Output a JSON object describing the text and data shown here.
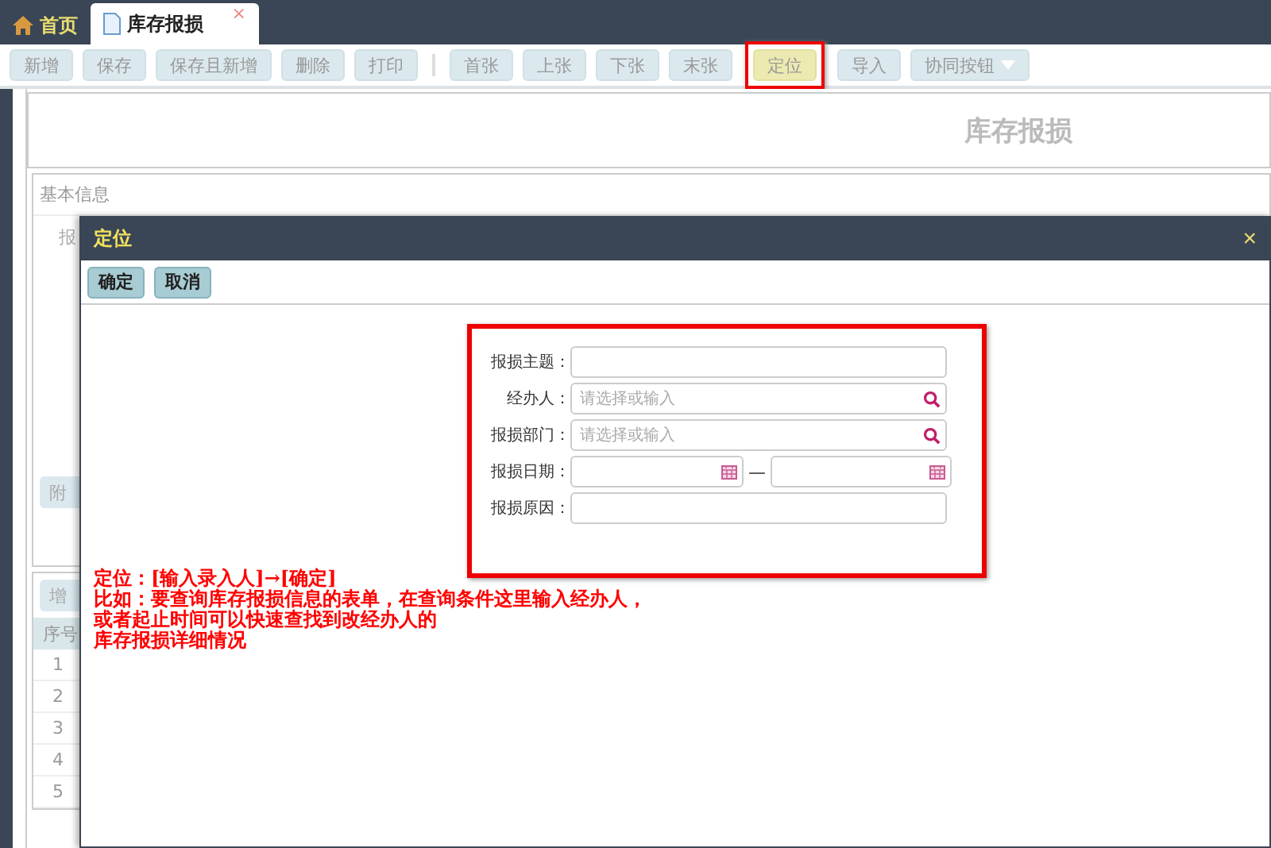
{
  "tabs": [
    {
      "label": "首页",
      "kind": "home",
      "selected": false
    },
    {
      "label": "库存报损",
      "kind": "doc",
      "selected": true,
      "close": "×"
    }
  ],
  "toolbar": [
    {
      "label": "新增",
      "highlighted": false
    },
    {
      "label": "保存",
      "highlighted": false
    },
    {
      "label": "保存且新增",
      "highlighted": false
    },
    {
      "label": "删除",
      "highlighted": false
    },
    {
      "label": "打印",
      "highlighted": false,
      "separator_after": true
    },
    {
      "label": "首张",
      "highlighted": false
    },
    {
      "label": "上张",
      "highlighted": false
    },
    {
      "label": "下张",
      "highlighted": false
    },
    {
      "label": "末张",
      "highlighted": false
    },
    {
      "label": "定位",
      "highlighted": true
    },
    {
      "label": "导入",
      "highlighted": false
    },
    {
      "label": "协同按钮",
      "highlighted": false,
      "dropdown": true
    }
  ],
  "page": {
    "title": "库存报损",
    "section": "基本信息",
    "field_label": "报",
    "attach_button": "附",
    "add_row_button": "增",
    "table": {
      "columns": [
        "序号"
      ],
      "rows": [
        "1",
        "2",
        "3",
        "4",
        "5"
      ]
    }
  },
  "dialog": {
    "title": "定位",
    "close": "×",
    "buttons": [
      "确定",
      "取消"
    ],
    "fields": [
      {
        "label": "报损主题：",
        "kind": "text"
      },
      {
        "label": "经办人：",
        "kind": "search",
        "placeholder": "请选择或输入"
      },
      {
        "label": "报损部门：",
        "kind": "search",
        "placeholder": "请选择或输入"
      },
      {
        "label": "报损日期：",
        "kind": "daterange",
        "separator": "—"
      },
      {
        "label": "报损原因：",
        "kind": "text"
      }
    ]
  },
  "annotation": [
    "定位：[输入录入人]→[确定]",
    "比如：要查询库存报损信息的表单，在查询条件这里输入经办人，",
    "或者起止时间可以快速查找到改经办人的",
    "库存报损详细情况"
  ]
}
